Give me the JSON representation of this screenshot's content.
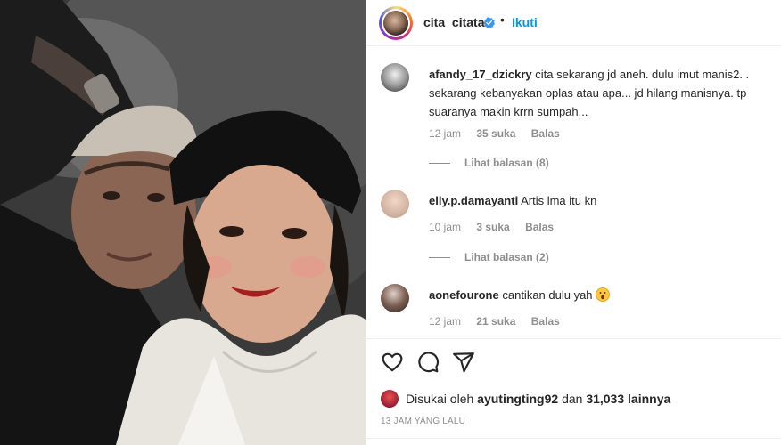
{
  "post": {
    "username": "cita_citata",
    "dot": "•",
    "follow_label": "Ikuti",
    "photo_icon": "selfie-photo"
  },
  "comments": [
    {
      "user": "afandy_17_dzickry",
      "text": "cita sekarang jd aneh. dulu imut manis2. . sekarang kebanyakan oplas atau apa... jd hilang manisnya. tp suaranya makin krrn sumpah...",
      "time": "12 jam",
      "likes": "35 suka",
      "reply": "Balas",
      "view_replies": "Lihat balasan (8)"
    },
    {
      "user": "elly.p.damayanti",
      "text": "Artis lma itu kn",
      "time": "10 jam",
      "likes": "3 suka",
      "reply": "Balas",
      "view_replies": "Lihat balasan (2)"
    },
    {
      "user": "aonefourone",
      "text": "cantikan dulu yah",
      "emoji_icon": "surprised-face-emoji",
      "time": "12 jam",
      "likes": "21 suka",
      "reply": "Balas"
    }
  ],
  "actions": {
    "like_icon": "heart-icon",
    "comment_icon": "comment-icon",
    "share_icon": "share-icon"
  },
  "likes_line": {
    "prefix": "Disukai oleh",
    "user": "ayutingting92",
    "middle": "dan",
    "count": "31,033",
    "suffix": "lainnya"
  },
  "timestamp": "13 JAM YANG LALU",
  "colors": {
    "accent": "#0095f6",
    "text": "#262626",
    "muted": "#8e8e8e",
    "verified": "#3897f0"
  }
}
